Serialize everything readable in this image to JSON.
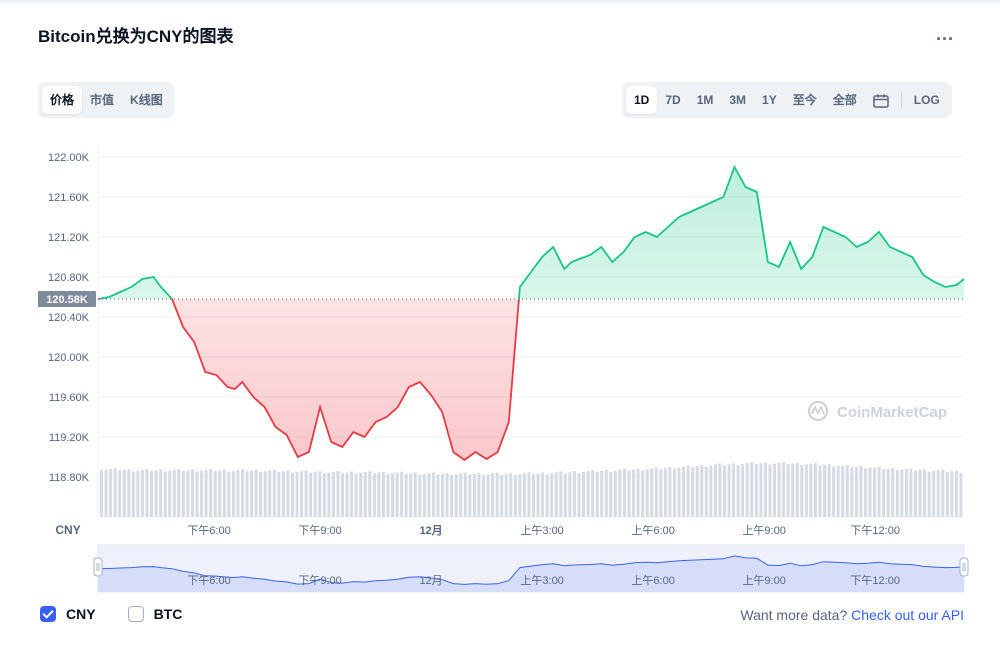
{
  "header": {
    "title": "Bitcoin兑换为CNY的图表",
    "more_label": "..."
  },
  "tabs_left": [
    {
      "label": "价格",
      "active": true
    },
    {
      "label": "市值",
      "active": false
    },
    {
      "label": "K线图",
      "active": false
    }
  ],
  "tabs_right": [
    {
      "label": "1D",
      "active": true
    },
    {
      "label": "7D",
      "active": false
    },
    {
      "label": "1M",
      "active": false
    },
    {
      "label": "3M",
      "active": false
    },
    {
      "label": "1Y",
      "active": false
    },
    {
      "label": "至今",
      "active": false
    },
    {
      "label": "全部",
      "active": false
    }
  ],
  "log_label": "LOG",
  "currency_label": "CNY",
  "watermark": "CoinMarketCap",
  "footer": {
    "cny_label": "CNY",
    "cny_checked": true,
    "btc_label": "BTC",
    "btc_checked": false,
    "more_data_text": "Want more data?",
    "api_link": "Check out our API"
  },
  "colors": {
    "up": "#16c784",
    "down": "#ea3943",
    "accent": "#3861fb",
    "baseline_tag": "#808a9d"
  },
  "chart_data": {
    "type": "line",
    "y_ticks": [
      "122.00K",
      "121.60K",
      "121.20K",
      "120.80K",
      "120.40K",
      "120.00K",
      "119.60K",
      "119.20K",
      "118.80K"
    ],
    "ylim": [
      118.8,
      122.0
    ],
    "y_unit": "K CNY",
    "x_ticks": [
      "下午6:00",
      "下午9:00",
      "12月",
      "上午3:00",
      "上午6:00",
      "上午9:00",
      "下午12:00"
    ],
    "x_tick_hours": [
      3,
      6,
      9,
      12,
      15,
      18,
      21
    ],
    "x_range_hours": [
      0,
      23.4
    ],
    "baseline": {
      "value": 120.58,
      "label": "120.58K"
    },
    "grid": true,
    "series": [
      {
        "x": [
          0,
          0.3,
          0.6,
          0.9,
          1.2,
          1.5,
          1.7,
          2.0,
          2.3,
          2.6,
          2.9,
          3.2,
          3.5,
          3.7,
          3.9,
          4.2,
          4.5,
          4.8,
          5.1,
          5.4,
          5.7,
          6.0,
          6.3,
          6.6,
          6.9,
          7.2,
          7.5,
          7.8,
          8.1,
          8.4,
          8.7,
          9.0,
          9.3,
          9.6,
          9.9,
          10.2,
          10.5,
          10.8,
          11.1,
          11.4,
          11.7,
          12.0,
          12.3,
          12.6,
          12.8,
          13.0,
          13.3,
          13.6,
          13.9,
          14.2,
          14.5,
          14.8,
          15.1,
          15.4,
          15.7,
          16.0,
          16.3,
          16.6,
          16.9,
          17.2,
          17.5,
          17.8,
          18.1,
          18.4,
          18.7,
          19.0,
          19.3,
          19.6,
          19.9,
          20.2,
          20.5,
          20.8,
          21.1,
          21.4,
          21.7,
          22.0,
          22.3,
          22.6,
          22.9,
          23.2,
          23.4
        ],
        "values": [
          120.58,
          120.6,
          120.65,
          120.7,
          120.78,
          120.8,
          120.7,
          120.58,
          120.3,
          120.15,
          119.85,
          119.82,
          119.7,
          119.68,
          119.75,
          119.6,
          119.5,
          119.3,
          119.22,
          119.0,
          119.05,
          119.5,
          119.15,
          119.1,
          119.25,
          119.2,
          119.35,
          119.4,
          119.5,
          119.7,
          119.75,
          119.62,
          119.45,
          119.05,
          118.97,
          119.05,
          118.98,
          119.05,
          119.35,
          120.7,
          120.85,
          121.0,
          121.1,
          120.88,
          120.95,
          120.98,
          121.02,
          121.1,
          120.95,
          121.05,
          121.2,
          121.25,
          121.2,
          121.3,
          121.4,
          121.45,
          121.5,
          121.55,
          121.6,
          121.9,
          121.7,
          121.65,
          120.95,
          120.9,
          121.15,
          120.88,
          121.0,
          121.3,
          121.25,
          121.2,
          121.1,
          121.15,
          121.25,
          121.1,
          121.05,
          121.0,
          120.82,
          120.75,
          120.7,
          120.72,
          120.78
        ]
      }
    ],
    "volume_relative": [
      0.52,
      0.5,
      0.5,
      0.5,
      0.5,
      0.49,
      0.48,
      0.47,
      0.47,
      0.46,
      0.45,
      0.45,
      0.45,
      0.46,
      0.48,
      0.5,
      0.52,
      0.55,
      0.58,
      0.6,
      0.6,
      0.58,
      0.55,
      0.52,
      0.5,
      0.48
    ]
  }
}
